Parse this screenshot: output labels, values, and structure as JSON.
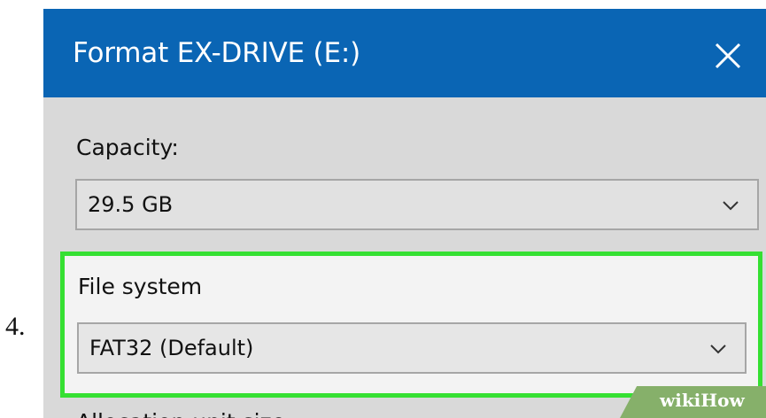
{
  "step_number": "4.",
  "dialog": {
    "title": "Format EX-DRIVE (E:)",
    "close_icon": "close-icon",
    "colors": {
      "titlebar": "#0a65b4",
      "body": "#d9d9d9",
      "highlight_border": "#35e032"
    }
  },
  "capacity": {
    "label": "Capacity:",
    "value": "29.5 GB"
  },
  "file_system": {
    "label": "File system",
    "value": "FAT32 (Default)"
  },
  "allocation_unit": {
    "label": "Allocation unit size"
  },
  "watermark": {
    "wiki": "wiki",
    "how": "How"
  }
}
